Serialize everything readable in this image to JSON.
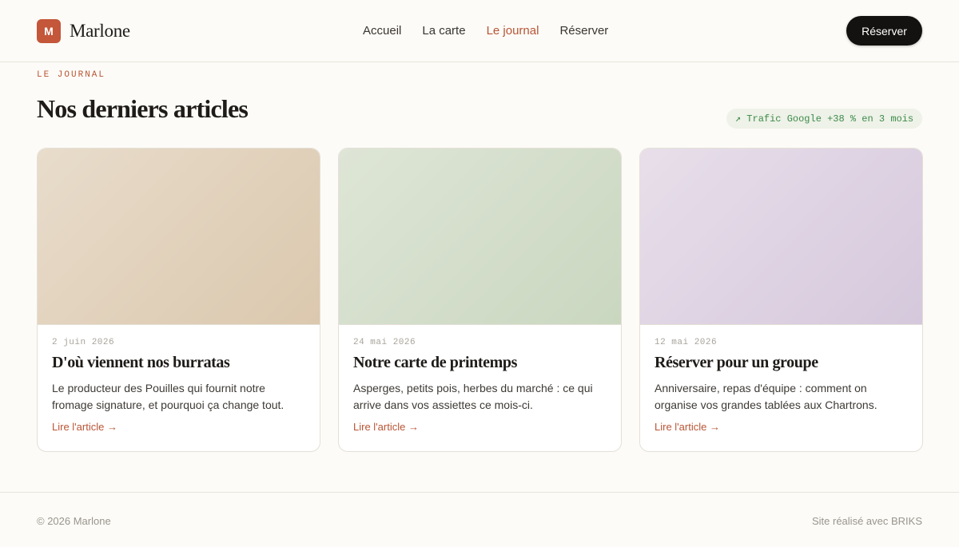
{
  "header": {
    "logo_letter": "M",
    "brand_name": "Marlone",
    "nav": [
      "Accueil",
      "La carte",
      "Le journal",
      "Réserver"
    ],
    "active_nav": "Le journal",
    "cta_label": "Réserver"
  },
  "section": {
    "eyebrow": "LE JOURNAL",
    "title": "Nos derniers articles",
    "traffic_badge": "↗ Trafic Google +38 % en 3 mois"
  },
  "articles": [
    {
      "date": "2 juin 2026",
      "title": "D'où viennent nos burratas",
      "excerpt": "Le producteur des Pouilles qui fournit notre fromage signature, et pourquoi ça change tout.",
      "link": "Lire l'article →",
      "gradient_from": "#e8dccb",
      "gradient_to": "#dbc8ae"
    },
    {
      "date": "24 mai 2026",
      "title": "Notre carte de printemps",
      "excerpt": "Asperges, petits pois, herbes du marché : ce qui arrive dans vos assiettes ce mois-ci.",
      "link": "Lire l'article →",
      "gradient_from": "#dee5d6",
      "gradient_to": "#cad7c0"
    },
    {
      "date": "12 mai 2026",
      "title": "Réserver pour un groupe",
      "excerpt": "Anniversaire, repas d'équipe : comment on organise vos grandes tablées aux Chartrons.",
      "link": "Lire l'article →",
      "gradient_from": "#e8dfea",
      "gradient_to": "#d5c8dc"
    }
  ],
  "footer": {
    "copyright": "© 2026 Marlone",
    "credit": "Site réalisé avec BRIKS"
  }
}
